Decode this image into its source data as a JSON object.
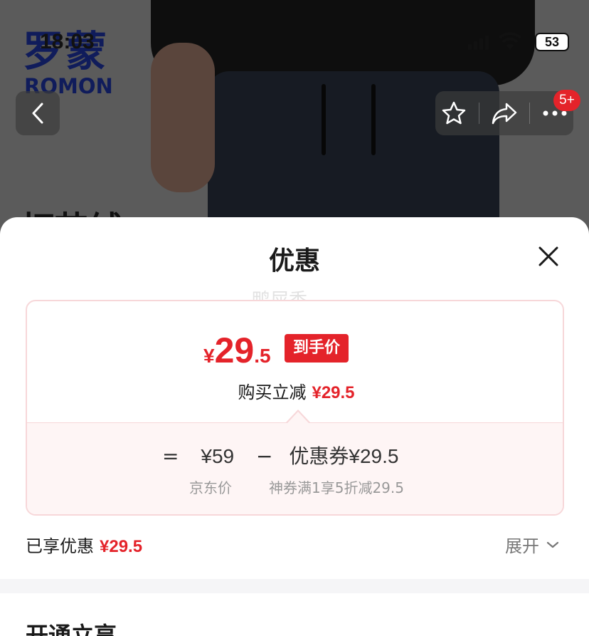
{
  "status_bar": {
    "time": "18:03",
    "battery": "53"
  },
  "brand": {
    "logo_cn": "罗蒙",
    "logo_en": "ROMON"
  },
  "photo_overlay_text": "灯芯绒",
  "nav": {
    "cart_badge": "5+"
  },
  "sheet": {
    "title": "优惠",
    "watermark": "鸭屎香",
    "final_price": {
      "currency": "¥",
      "integer": "29",
      "decimal": ".5",
      "tag": "到手价"
    },
    "instant_cut": {
      "label": "购买立减",
      "amount": "¥29.5"
    },
    "calc": {
      "equals": "=",
      "base_price": "¥59",
      "minus": "−",
      "coupon_label": "优惠券",
      "coupon_amount": "¥29.5",
      "base_caption": "京东价",
      "coupon_caption": "神券满1享5折减29.5"
    },
    "enjoyed": {
      "label": "已享优惠",
      "amount": "¥29.5"
    },
    "expand_label": "展开",
    "next_section_title": "开通立享"
  },
  "colors": {
    "accent_red": "#e4232a",
    "card_border": "#f7d7d9",
    "card_pink_bg": "#fef5f5"
  }
}
